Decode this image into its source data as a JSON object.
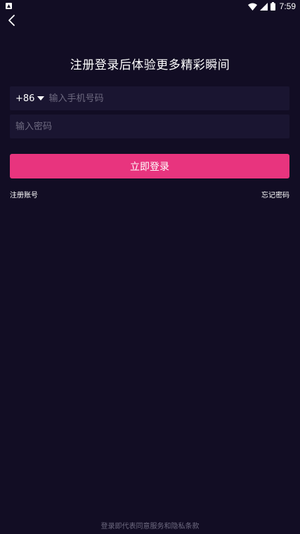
{
  "status_bar": {
    "time": "7:59",
    "icons": [
      "app-notification-icon",
      "wifi-icon",
      "signal-icon",
      "battery-icon"
    ]
  },
  "header": {
    "back_icon": "chevron-left-icon"
  },
  "title": "注册登录后体验更多精彩瞬间",
  "phone": {
    "country_code": "+86",
    "placeholder": "输入手机号码",
    "value": ""
  },
  "password": {
    "placeholder": "输入密码",
    "value": ""
  },
  "login_button_label": "立即登录",
  "links": {
    "register": "注册账号",
    "forgot_password": "忘记密码"
  },
  "terms": "登录即代表同意服务和隐私条款",
  "colors": {
    "background": "#120d24",
    "field_background": "#1a1531",
    "accent": "#e8347e",
    "placeholder": "#6e6a80"
  }
}
